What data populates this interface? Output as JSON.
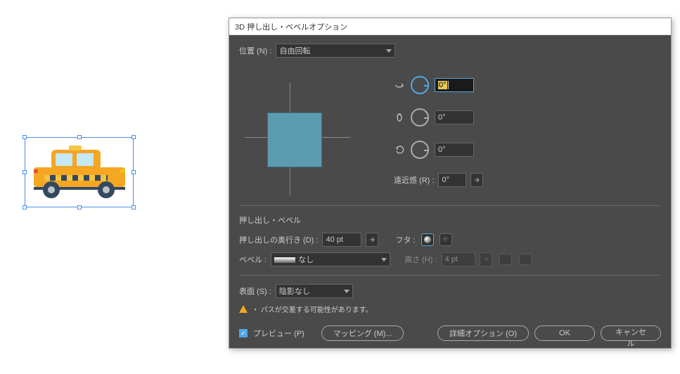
{
  "dialog": {
    "title": "3D 押し出し・ベベルオプション",
    "position_label": "位置 (N) :",
    "position_value": "自由回転",
    "rot_x": "0°",
    "rot_y": "0°",
    "rot_z": "0°",
    "perspective_label": "遠近感 (R) :",
    "perspective_value": "0°",
    "extrude_section": "押し出し・ベベル",
    "depth_label": "押し出しの奥行き (D) :",
    "depth_value": "40 pt",
    "cap_label": "フタ :",
    "bevel_label": "ベベル :",
    "bevel_value": "なし",
    "height_label": "高さ (H) :",
    "height_value": "4 pt",
    "surface_label": "表面 (S) :",
    "surface_value": "陰影なし",
    "warning": "・ パスが交差する可能性があります。",
    "preview_label": "プレビュー (P)",
    "btn_mapping": "マッピング (M)...",
    "btn_more": "詳細オプション (O)",
    "btn_ok": "OK",
    "btn_cancel": "キャンセル"
  }
}
